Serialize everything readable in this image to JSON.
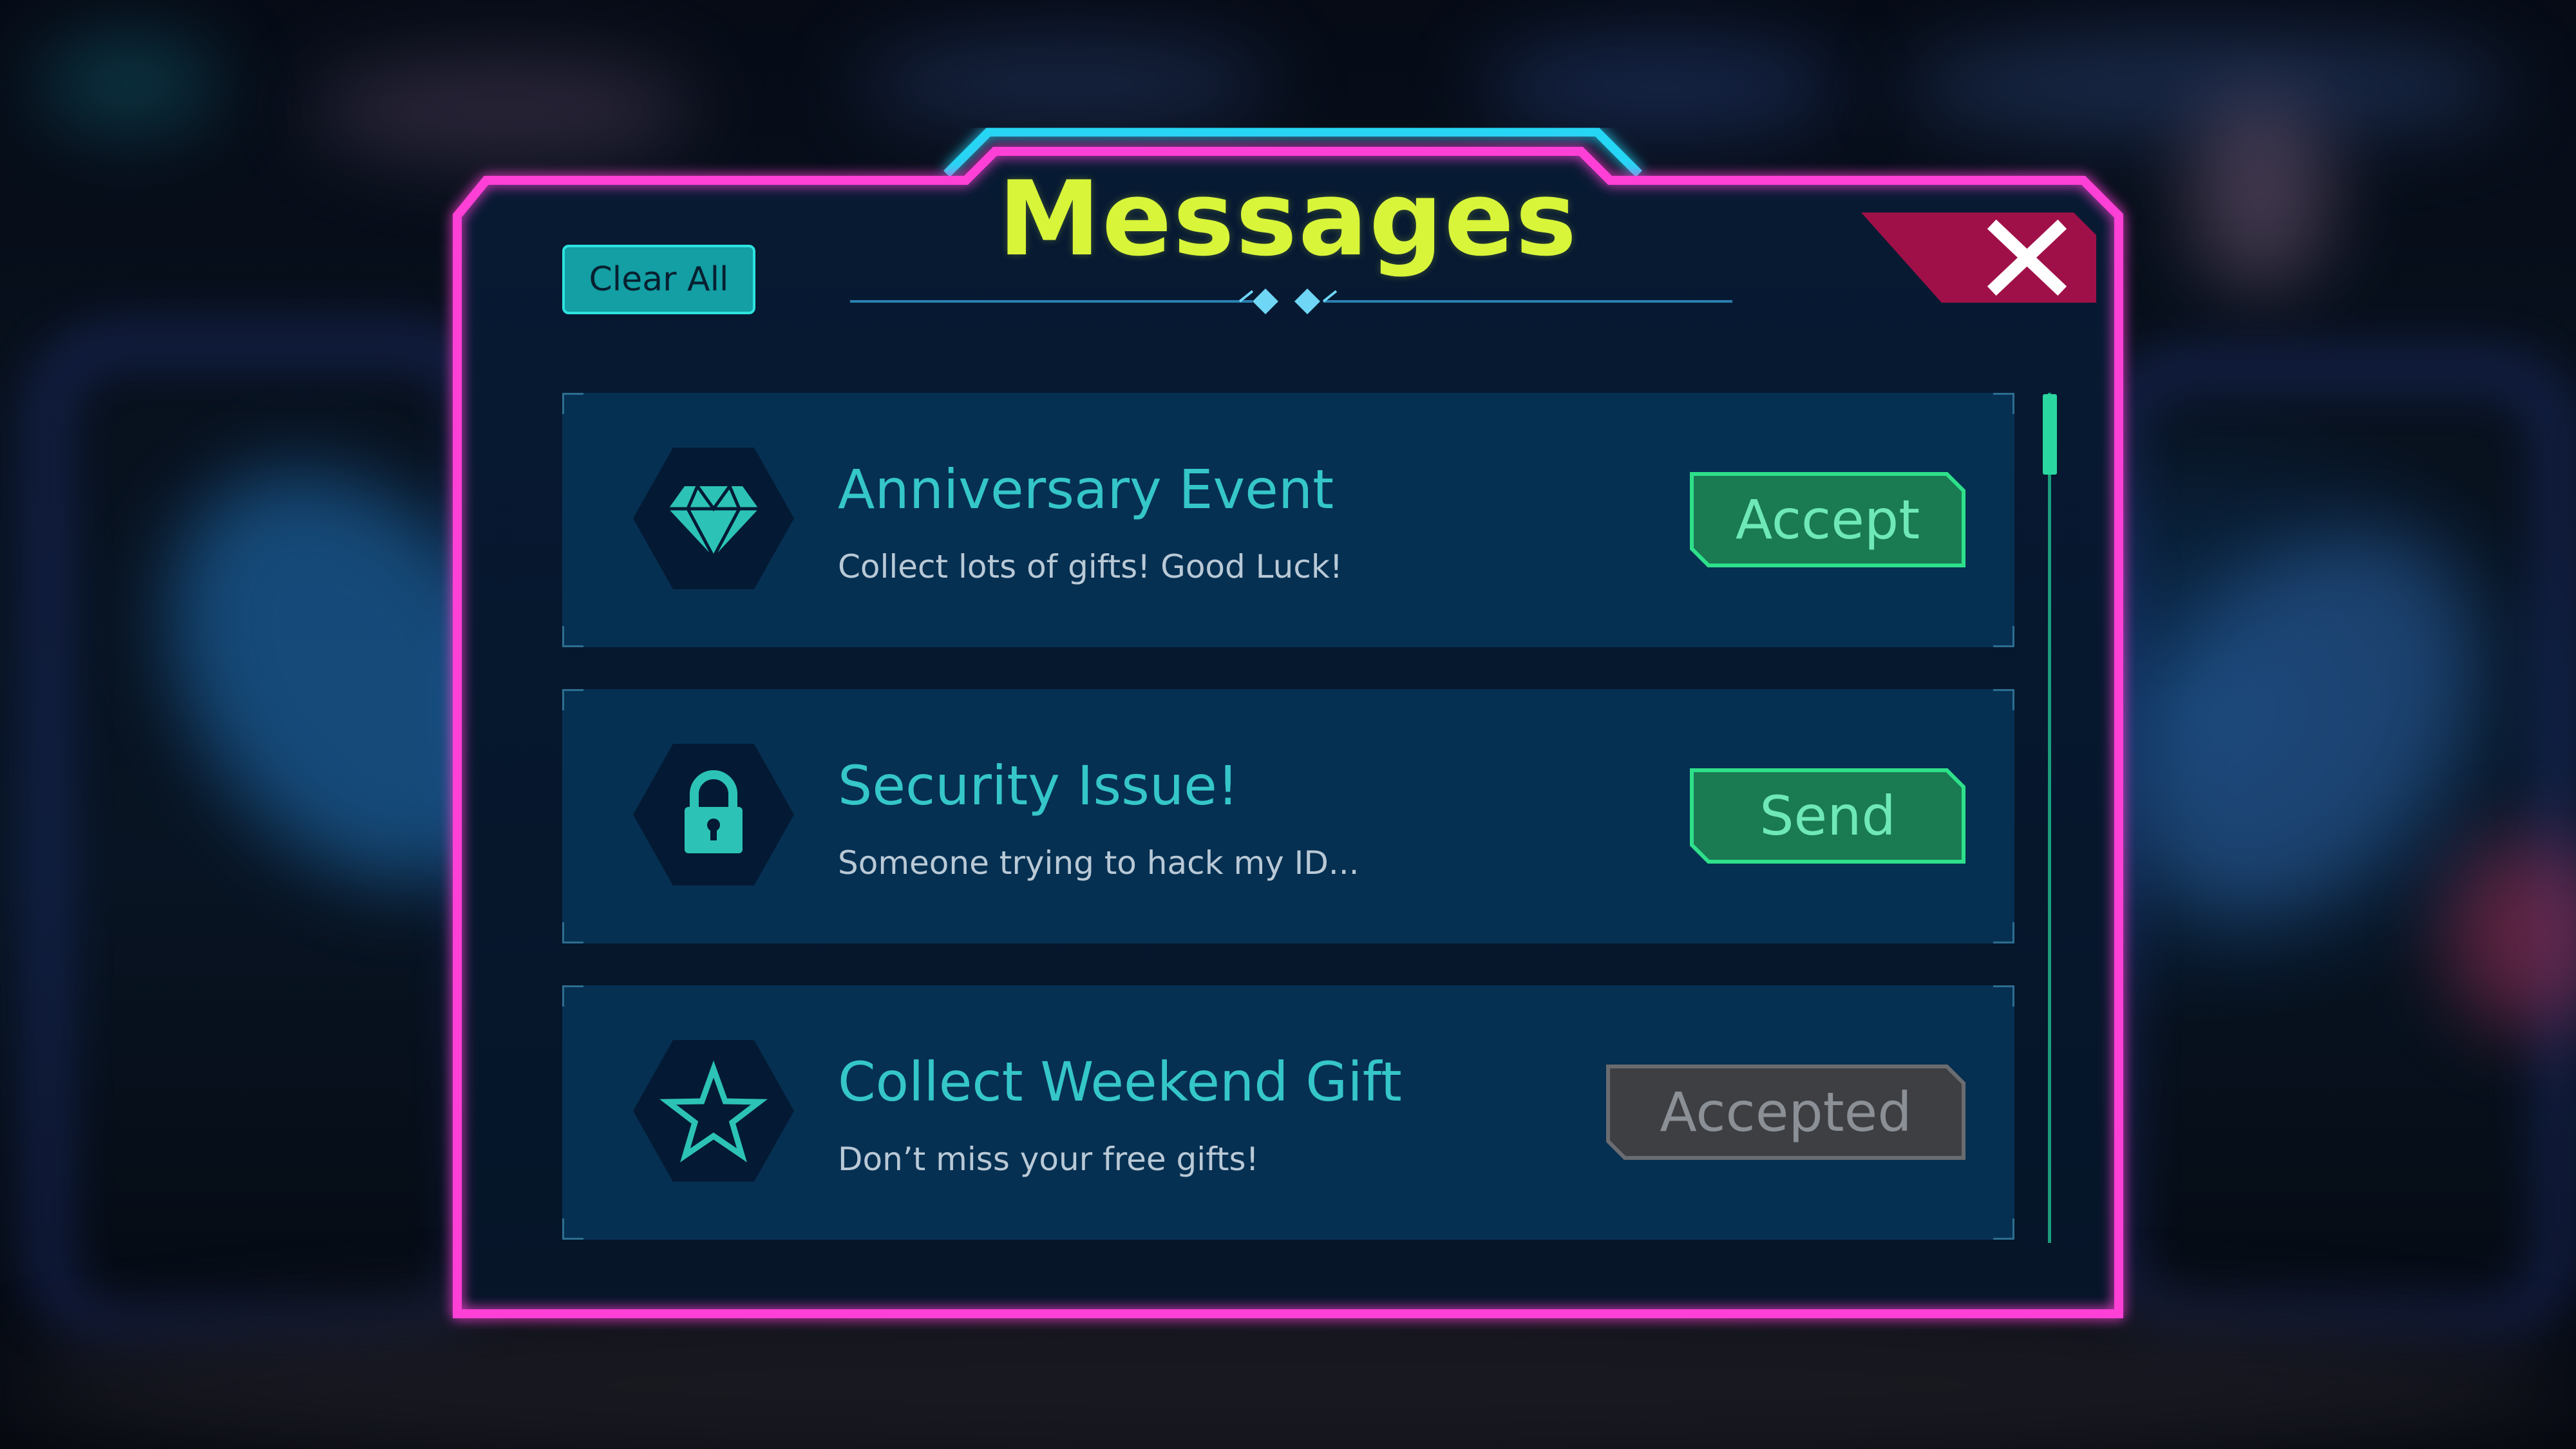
{
  "dialog": {
    "title": "Messages",
    "clear_all_label": "Clear All",
    "close_icon": "close-x-icon"
  },
  "messages": [
    {
      "icon": "diamond-icon",
      "title": "Anniversary Event",
      "subtitle": "Collect lots of gifts! Good Luck!",
      "action_label": "Accept",
      "action_state": "active"
    },
    {
      "icon": "lock-icon",
      "title": "Security Issue!",
      "subtitle": "Someone trying to hack my ID...",
      "action_label": "Send",
      "action_state": "active"
    },
    {
      "icon": "star-icon",
      "title": "Collect Weekend Gift",
      "subtitle": "Don’t miss your free gifts!",
      "action_label": "Accepted",
      "action_state": "disabled"
    }
  ],
  "scrollbar": {
    "position": 0.0
  },
  "colors": {
    "frame_pink": "#ff3fd6",
    "frame_cyan": "#25d6f5",
    "title_yellow": "#d8f53a",
    "panel_bg": "#071a33",
    "card_bg": "#063052",
    "accent_teal": "#35c6c9",
    "button_green": "#1a7a52",
    "button_border": "#2ee08a",
    "disabled_gray": "#3e3f42",
    "close_red": "#a01048"
  }
}
